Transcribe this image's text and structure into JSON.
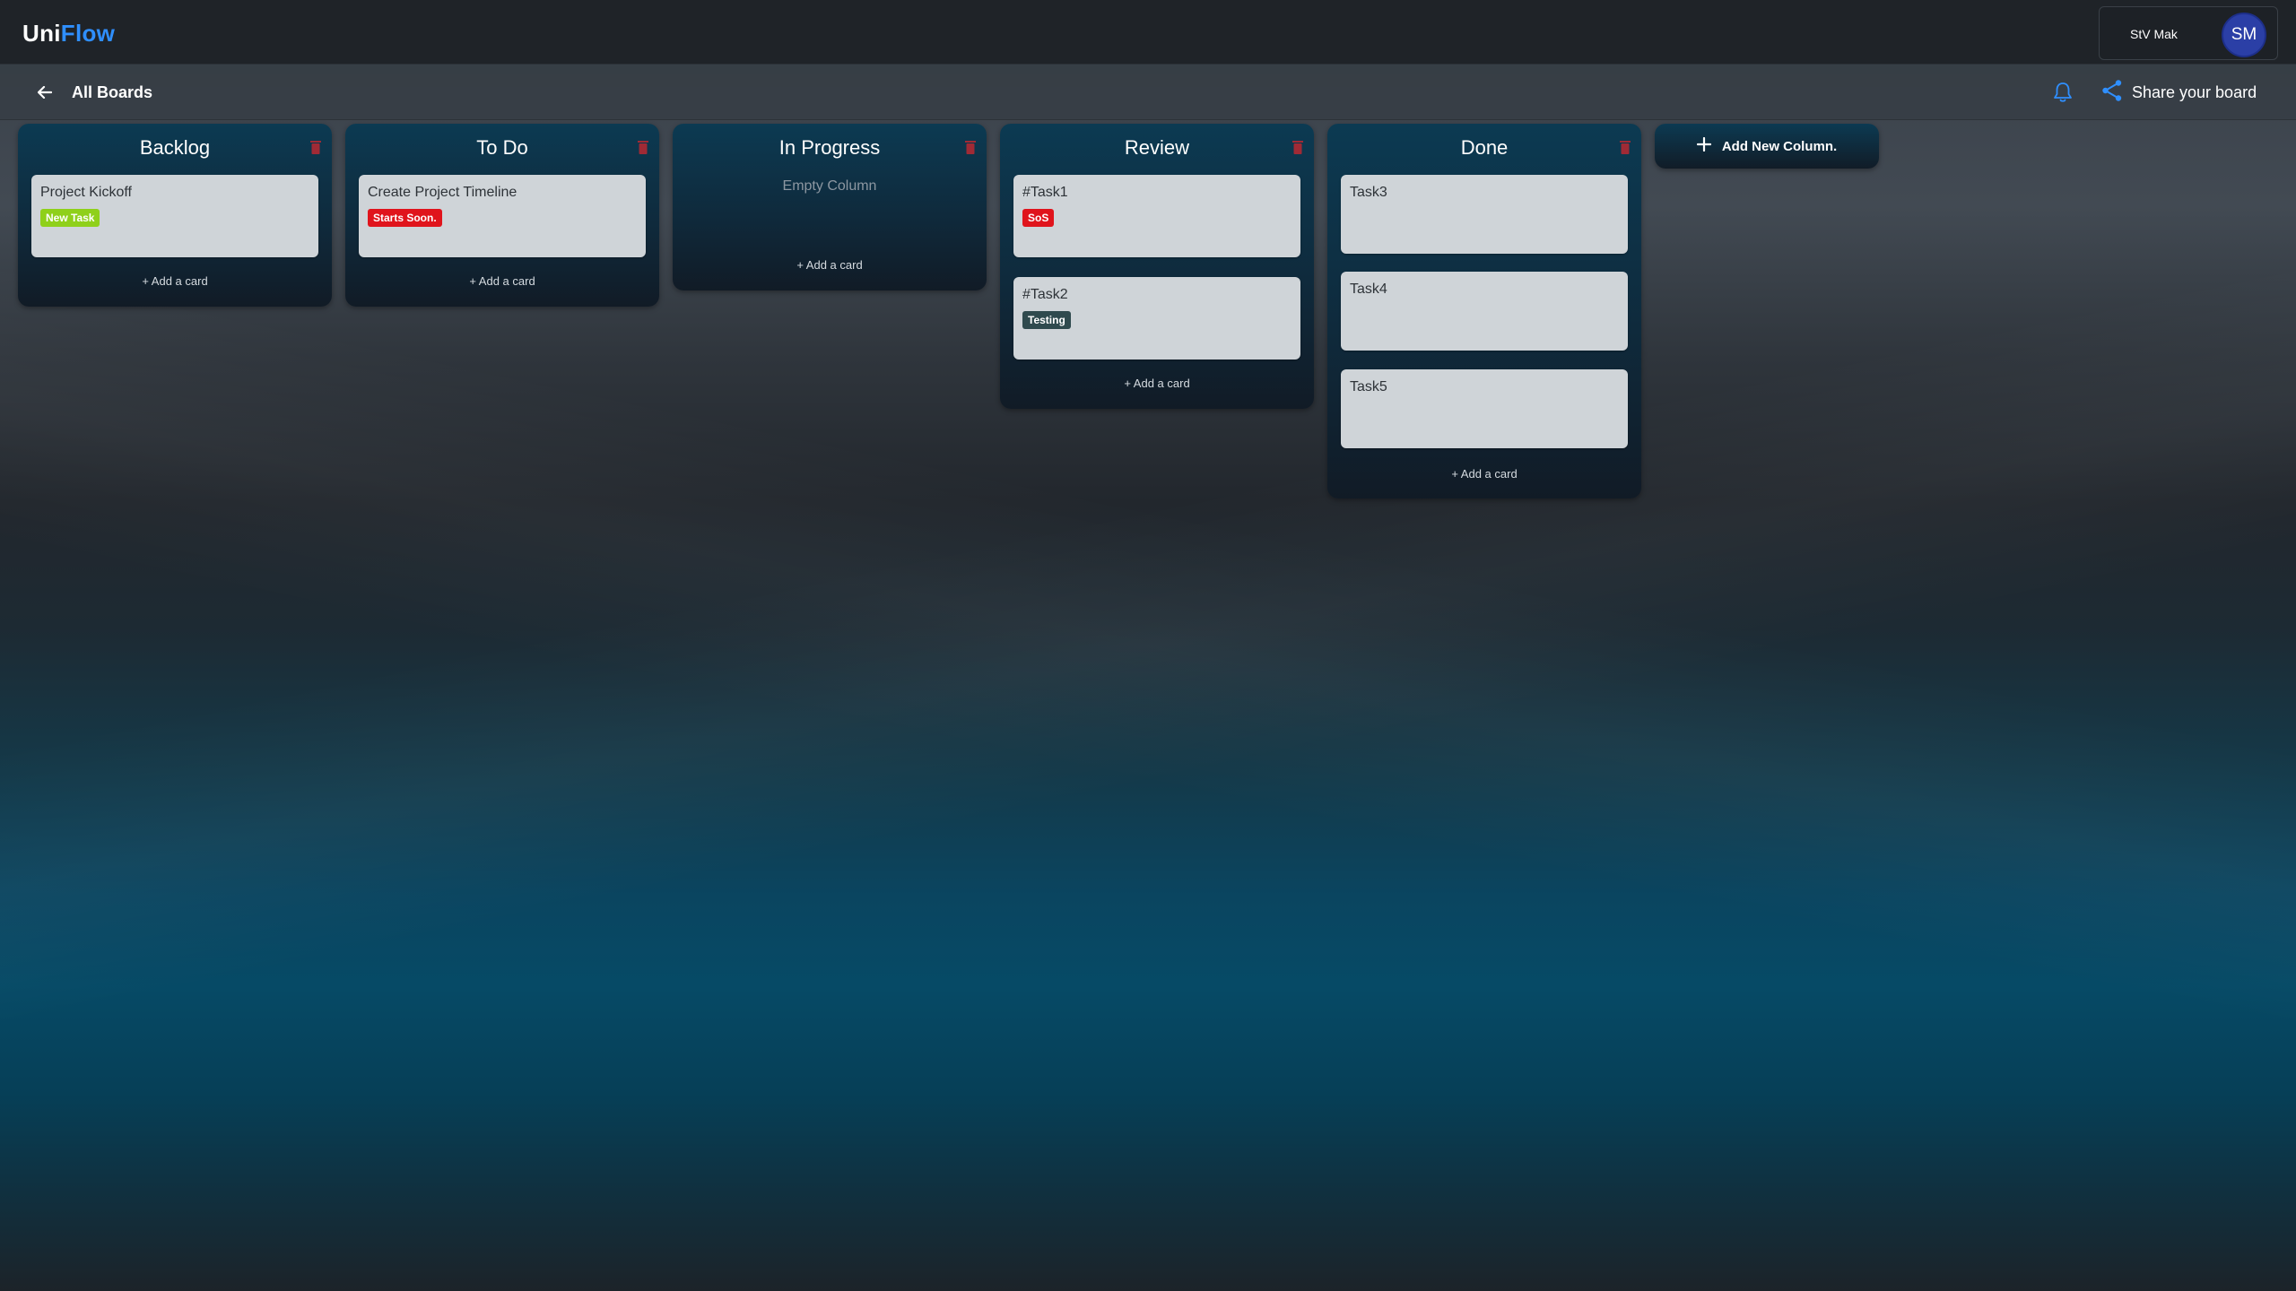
{
  "app": {
    "logo_part1": "Uni",
    "logo_part2": "Flow"
  },
  "user": {
    "name": "StV Mak",
    "initials": "SM"
  },
  "subbar": {
    "back_label": "All Boards",
    "share_label": "Share your board"
  },
  "colors": {
    "brand_blue": "#2f8fff",
    "card_bg": "#cfd4d8",
    "tag_green": "#8fd01a",
    "tag_red": "#e0141c",
    "tag_dark": "#2f4a4e",
    "trash_red": "#a02a35"
  },
  "icons": {
    "back": "arrow-left-icon",
    "bell": "bell-icon",
    "share": "share-icon",
    "trash": "trash-icon",
    "plus": "plus-icon"
  },
  "columns": [
    {
      "title": "Backlog",
      "cards": [
        {
          "title": "Project Kickoff",
          "tag": "New Task"
        }
      ],
      "add_label": "+ Add a card"
    },
    {
      "title": "To Do",
      "cards": [
        {
          "title": "Create Project Timeline",
          "tag": "Starts Soon."
        }
      ],
      "add_label": "+ Add a card"
    },
    {
      "title": "In Progress",
      "empty_text": "Empty Column",
      "add_label": "+ Add a card"
    },
    {
      "title": "Review",
      "cards": [
        {
          "title": "#Task1",
          "tag": "SoS"
        },
        {
          "title": "#Task2",
          "tag": "Testing"
        }
      ],
      "add_label": "+ Add a card"
    },
    {
      "title": "Done",
      "cards": [
        {
          "title": "Task3"
        },
        {
          "title": "Task4"
        },
        {
          "title": "Task5"
        }
      ],
      "add_label": "+ Add a card"
    }
  ],
  "add_column_label": "Add New Column."
}
